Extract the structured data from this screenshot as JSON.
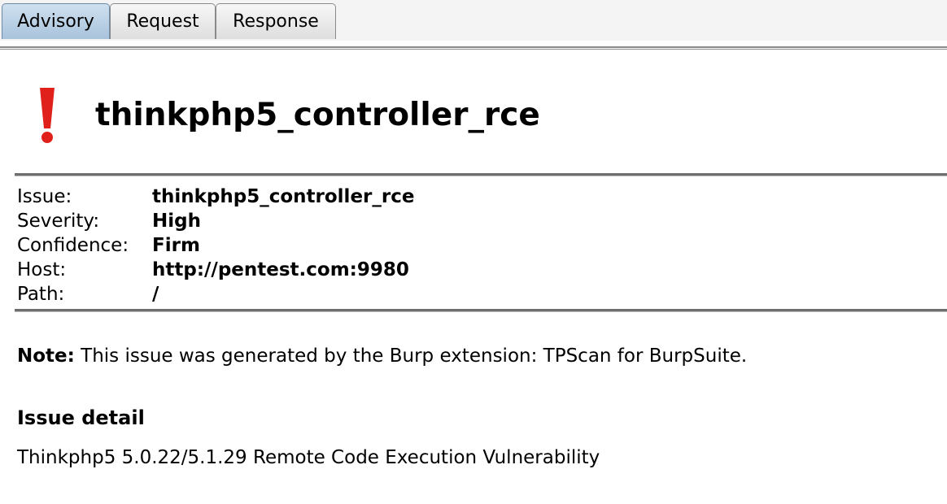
{
  "tabs": {
    "advisory": "Advisory",
    "request": "Request",
    "response": "Response",
    "active": "Advisory"
  },
  "issue_icon": "exclamation-icon",
  "colors": {
    "severity_icon": "#e0201b",
    "active_tab": "#a8c3dc"
  },
  "title": "thinkphp5_controller_rce",
  "details": {
    "issue": {
      "label": "Issue:",
      "value": "thinkphp5_controller_rce"
    },
    "severity": {
      "label": "Severity:",
      "value": "High"
    },
    "confidence": {
      "label": "Confidence:",
      "value": "Firm"
    },
    "host": {
      "label": "Host:",
      "value": "http://pentest.com:9980"
    },
    "path": {
      "label": "Path:",
      "value": "/"
    }
  },
  "note": {
    "label": "Note:",
    "text": " This issue was generated by the Burp extension: TPScan for BurpSuite."
  },
  "issue_detail": {
    "heading": "Issue detail",
    "text": "Thinkphp5 5.0.22/5.1.29 Remote Code Execution Vulnerability"
  }
}
